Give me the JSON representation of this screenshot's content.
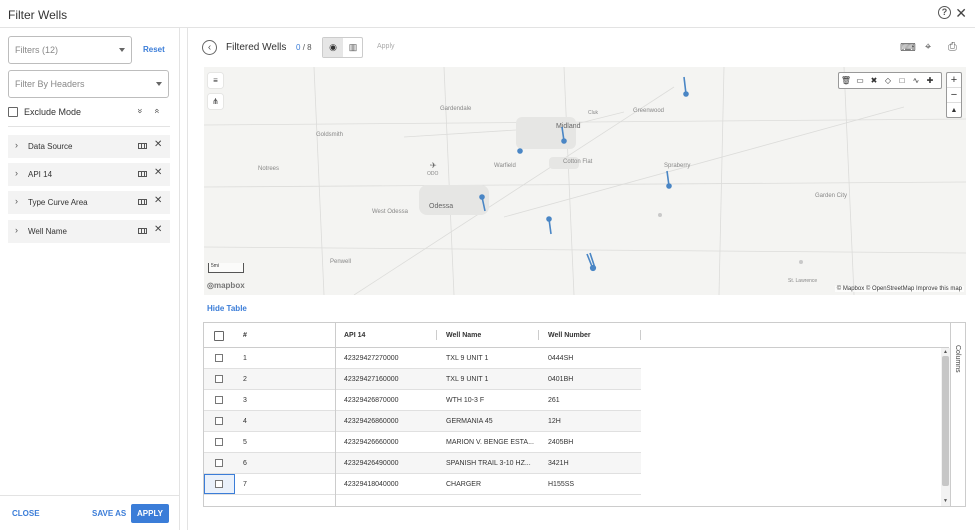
{
  "window": {
    "title": "Filter Wells",
    "help_icon": "?",
    "close_icon": "✕"
  },
  "sidebar": {
    "filters_placeholder": "Filters (12)",
    "reset_label": "Reset",
    "filter_by_headers_placeholder": "Filter By Headers",
    "exclude_mode_label": "Exclude Mode",
    "expand_all_icon": "»",
    "collapse_all_icon": "«",
    "items": [
      {
        "label": "Data Source"
      },
      {
        "label": "API 14"
      },
      {
        "label": "Type Curve Area"
      },
      {
        "label": "Well Name"
      }
    ],
    "footer": {
      "close_label": "CLOSE",
      "save_as_label": "SAVE AS",
      "apply_label": "APPLY"
    }
  },
  "toolbar": {
    "back_icon": "‹",
    "title": "Filtered Wells",
    "count_selected": "0",
    "count_total": "/ 8",
    "globe_icon": "◉",
    "chart_icon": "▥",
    "apply_label": "Apply",
    "keyboard_icon": "⌨",
    "locate_icon": "⌖",
    "print_icon": "⎙"
  },
  "map": {
    "layers_icon": "≡",
    "wells_icon": "⋔",
    "draw_tools": [
      "🗑",
      "▭",
      "✖",
      "◇",
      "□",
      "∿",
      "✚"
    ],
    "zoom_in": "+",
    "zoom_out": "−",
    "compass_icon": "▲",
    "scale_label": "5mi",
    "mapbox_logo": "◎mapbox",
    "attribution": "© Mapbox © OpenStreetMap  Improve this map",
    "places": [
      {
        "name": "Gardendale"
      },
      {
        "name": "Midland"
      },
      {
        "name": "Greenwood"
      },
      {
        "name": "Goldsmith"
      },
      {
        "name": "Notrees"
      },
      {
        "name": "Warfield"
      },
      {
        "name": "Cotton Flat"
      },
      {
        "name": "Spraberry"
      },
      {
        "name": "Garden City"
      },
      {
        "name": "West Odessa"
      },
      {
        "name": "Odessa"
      },
      {
        "name": "ODO"
      },
      {
        "name": "Penwell"
      },
      {
        "name": "St. Lawrence"
      },
      {
        "name": "Cluk"
      }
    ]
  },
  "table": {
    "hide_label": "Hide Table",
    "columns": [
      "#",
      "API 14",
      "Well Name",
      "Well Number"
    ],
    "side_panel_label": "Columns",
    "rows": [
      [
        "1",
        "42329427270000",
        "TXL 9 UNIT 1",
        "0444SH"
      ],
      [
        "2",
        "42329427160000",
        "TXL 9 UNIT 1",
        "0401BH"
      ],
      [
        "3",
        "42329426870000",
        "WTH 10-3 F",
        "261"
      ],
      [
        "4",
        "42329426860000",
        "GERMANIA 45",
        "12H"
      ],
      [
        "5",
        "42329426660000",
        "MARION V. BENGE ESTA...",
        "2405BH"
      ],
      [
        "6",
        "42329426490000",
        "SPANISH TRAIL 3-10 HZ...",
        "3421H"
      ],
      [
        "7",
        "42329418040000",
        "CHARGER",
        "H155SS"
      ]
    ]
  }
}
